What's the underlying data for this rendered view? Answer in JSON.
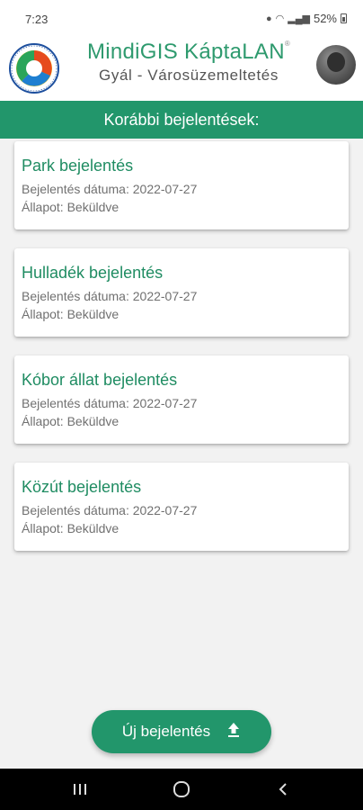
{
  "status_bar": {
    "time": "7:23",
    "battery": "52%"
  },
  "header": {
    "brand_part1": "MindiGIS",
    "brand_part2": "KáptaLAN",
    "registered": "®",
    "subtitle": "Gyál - Városüzemeltetés"
  },
  "section": {
    "title": "Korábbi bejelentések:"
  },
  "reports": [
    {
      "title": "Park bejelentés",
      "date": "Bejelentés dátuma: 2022-07-27",
      "status": "Állapot: Beküldve"
    },
    {
      "title": "Hulladék bejelentés",
      "date": "Bejelentés dátuma: 2022-07-27",
      "status": "Állapot: Beküldve"
    },
    {
      "title": "Kóbor állat bejelentés",
      "date": "Bejelentés dátuma: 2022-07-27",
      "status": "Állapot: Beküldve"
    },
    {
      "title": "Közút bejelentés",
      "date": "Bejelentés dátuma: 2022-07-27",
      "status": "Állapot: Beküldve"
    }
  ],
  "fab": {
    "label": "Új bejelentés",
    "icon": "upload-icon"
  },
  "colors": {
    "primary": "#22966b",
    "title_text": "#1f8c62",
    "muted_text": "#707070"
  }
}
